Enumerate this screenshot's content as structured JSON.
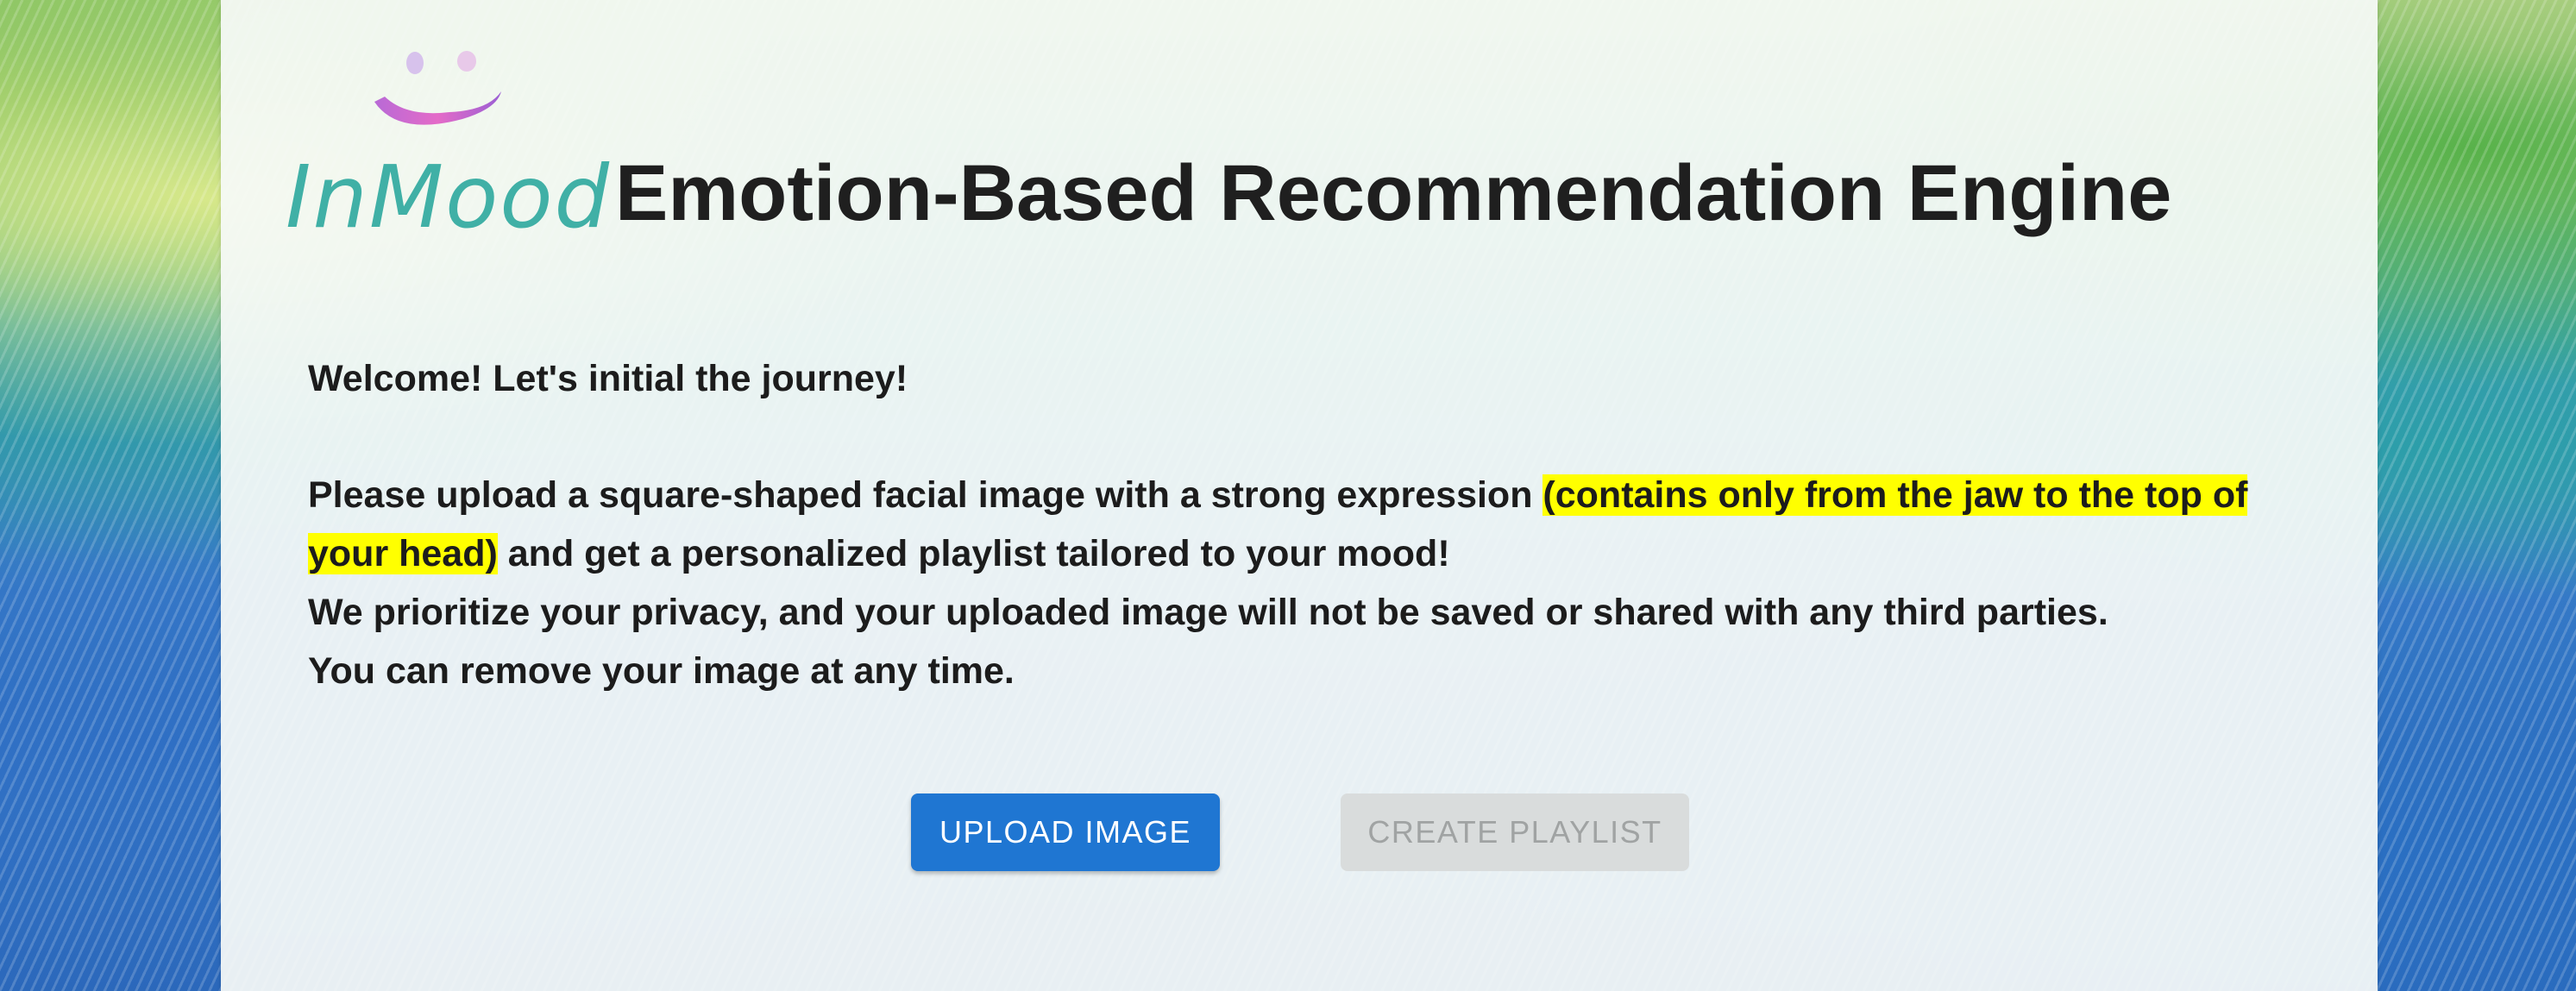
{
  "logo": {
    "text": "InMood",
    "icon": "smile-icon"
  },
  "header": {
    "title": "Emotion-Based Recommendation Engine"
  },
  "intro": {
    "welcome": "Welcome! Let's initial the journey!",
    "instruction_before": "Please upload a square-shaped facial image with a strong expression ",
    "instruction_highlight": "(contains only from the jaw to the top of your head)",
    "instruction_after": " and get a personalized playlist tailored to your mood!",
    "privacy": "We prioritize your privacy, and your uploaded image will not be saved or shared with any third parties.",
    "remove": "You can remove your image at any time."
  },
  "actions": {
    "upload_label": "UPLOAD IMAGE",
    "create_label": "CREATE PLAYLIST"
  },
  "colors": {
    "primary": "#1f76d2",
    "disabled": "#d9dcdc",
    "highlight": "#ffff00",
    "logo": "#40b0a6"
  }
}
